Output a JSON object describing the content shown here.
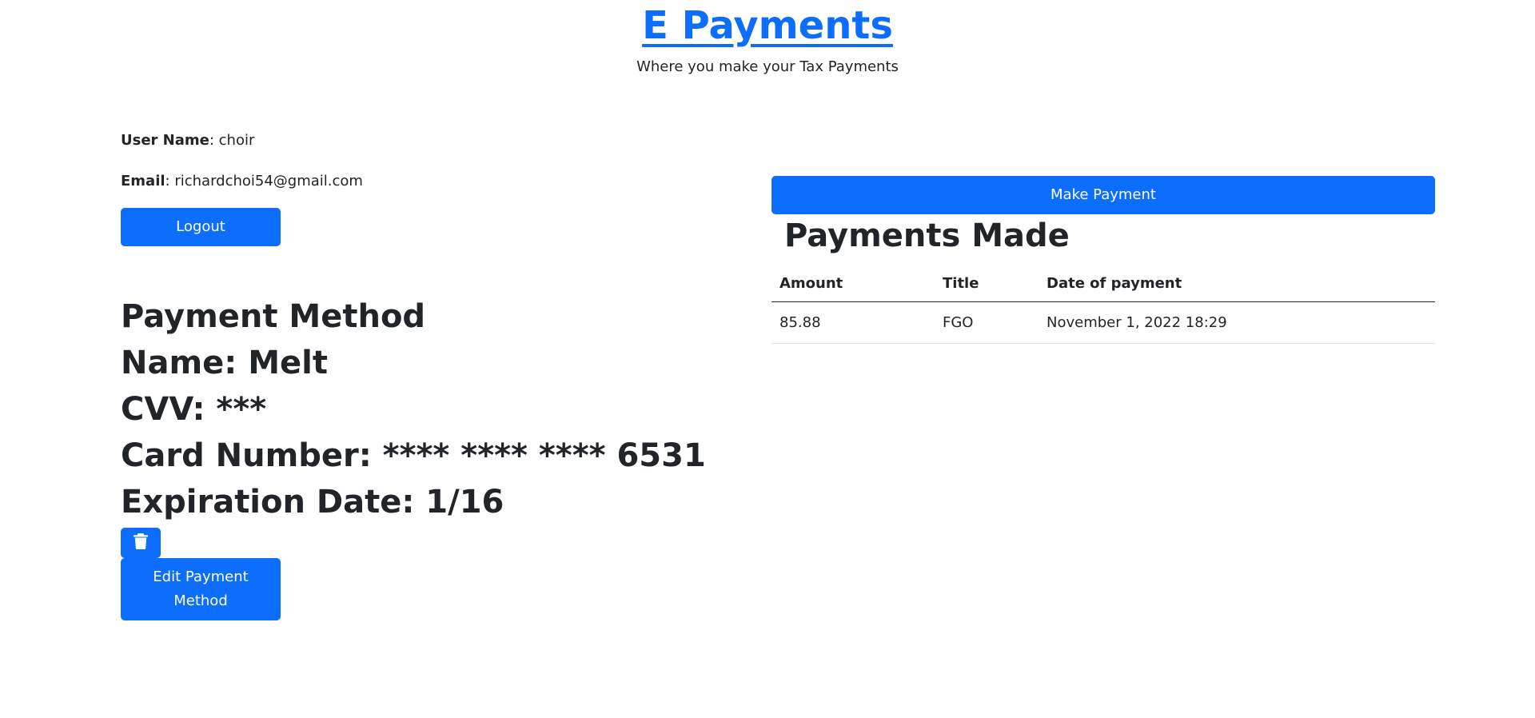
{
  "header": {
    "title": "E Payments",
    "subtitle": "Where you make your Tax Payments"
  },
  "user": {
    "username_label": "User Name",
    "username_value": ": choir",
    "email_label": "Email",
    "email_value": ": richardchoi54@gmail.com",
    "logout_label": "Logout"
  },
  "payment_method": {
    "heading": "Payment Method",
    "name": "Name: Melt",
    "cvv": "CVV: ***",
    "card_number": "Card Number: **** **** **** 6531",
    "expiration": "Expiration Date: 1/16",
    "delete_icon": "trash-icon",
    "edit_label": "Edit Payment Method"
  },
  "payments": {
    "make_payment_label": "Make Payment",
    "heading": "Payments Made",
    "columns": [
      "Amount",
      "Title",
      "Date of payment"
    ],
    "rows": [
      [
        "85.88",
        "FGO",
        "November 1, 2022 18:29"
      ]
    ]
  },
  "colors": {
    "primary": "#0d6efd",
    "text": "#212529"
  }
}
